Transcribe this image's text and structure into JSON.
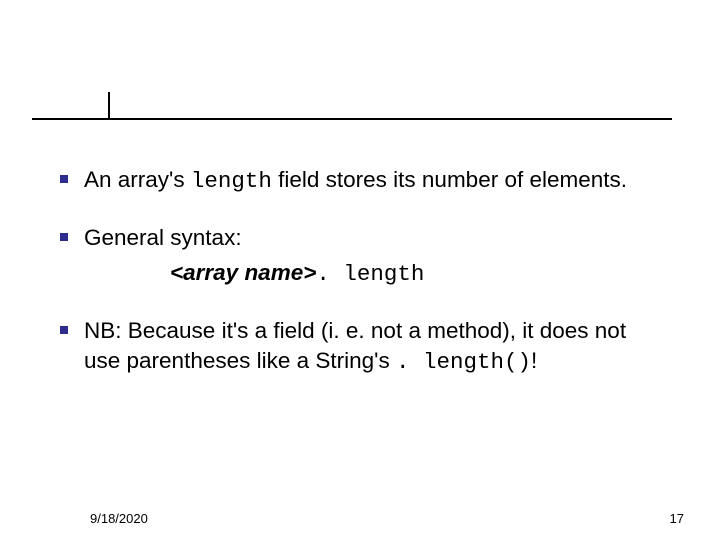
{
  "bullets": {
    "b1_pre": "An array's ",
    "b1_code": "length",
    "b1_post": " field stores its number of elements.",
    "b2": "General syntax:",
    "syntax_arr": "<array name>",
    "syntax_tail": ". length",
    "b3_pre": "NB: Because it's a field (i. e. not a method), it does not use parentheses like a String's ",
    "b3_code": ". length()",
    "b3_post": "!"
  },
  "footer": {
    "date": "9/18/2020",
    "page": "17"
  }
}
